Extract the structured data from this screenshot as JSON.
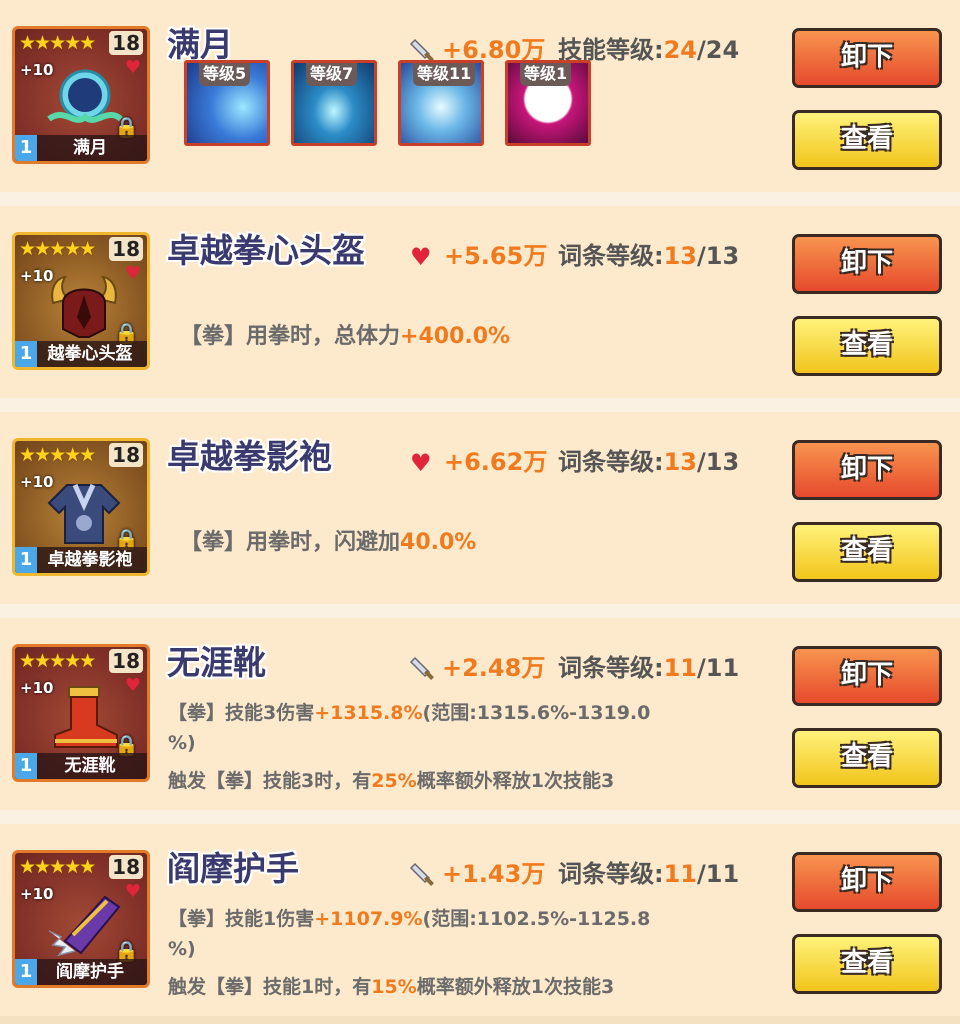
{
  "items": [
    {
      "name": "满月",
      "stars": "★★★★★",
      "level": "18",
      "plus": "+10",
      "caption": "满月",
      "badge": "1",
      "power": "+6.80万",
      "power_icon": "sword-icon",
      "level_label": "技能等级:",
      "level_current": "24",
      "level_max": "/24",
      "skills": [
        {
          "tag": "等级5"
        },
        {
          "tag": "等级7"
        },
        {
          "tag": "等级11"
        },
        {
          "tag": "等级1"
        }
      ],
      "unload": "卸下",
      "view": "查看"
    },
    {
      "name": "卓越拳心头盔",
      "stars": "★★★★★",
      "level": "18",
      "plus": "+10",
      "caption": "越拳心头盔",
      "badge": "1",
      "power": "+5.65万",
      "power_icon": "heart-icon",
      "level_label": "词条等级:",
      "level_current": "13",
      "level_max": "/13",
      "desc_prefix": "【拳】用拳时，总体力",
      "desc_value": "+400.0%",
      "unload": "卸下",
      "view": "查看"
    },
    {
      "name": "卓越拳影袍",
      "stars": "★★★★★",
      "level": "18",
      "plus": "+10",
      "caption": "卓越拳影袍",
      "badge": "1",
      "power": "+6.62万",
      "power_icon": "heart-icon",
      "level_label": "词条等级:",
      "level_current": "13",
      "level_max": "/13",
      "desc_prefix": "【拳】用拳时，闪避加",
      "desc_value": "40.0%",
      "unload": "卸下",
      "view": "查看"
    },
    {
      "name": "无涯靴",
      "stars": "★★★★★",
      "level": "18",
      "plus": "+10",
      "caption": "无涯靴",
      "badge": "1",
      "power": "+2.48万",
      "power_icon": "sword-icon",
      "level_label": "词条等级:",
      "level_current": "11",
      "level_max": "/11",
      "line1_prefix": "【拳】技能3伤害",
      "line1_value": "+1315.8%",
      "line1_suffix": "(范围:1315.6%-1319.0",
      "line2": "%)",
      "line3_prefix": "触发【拳】技能3时，有",
      "line3_value": "25%",
      "line3_suffix": "概率额外释放1次技能3",
      "unload": "卸下",
      "view": "查看"
    },
    {
      "name": "阎摩护手",
      "stars": "★★★★★",
      "level": "18",
      "plus": "+10",
      "caption": "阎摩护手",
      "badge": "1",
      "power": "+1.43万",
      "power_icon": "sword-icon",
      "level_label": "词条等级:",
      "level_current": "11",
      "level_max": "/11",
      "line1_prefix": "【拳】技能1伤害",
      "line1_value": "+1107.9%",
      "line1_suffix": "(范围:1102.5%-1125.8",
      "line2": "%)",
      "line3_prefix": "触发【拳】技能1时，有",
      "line3_value": "15%",
      "line3_suffix": "概率额外释放1次技能3",
      "unload": "卸下",
      "view": "查看"
    }
  ]
}
